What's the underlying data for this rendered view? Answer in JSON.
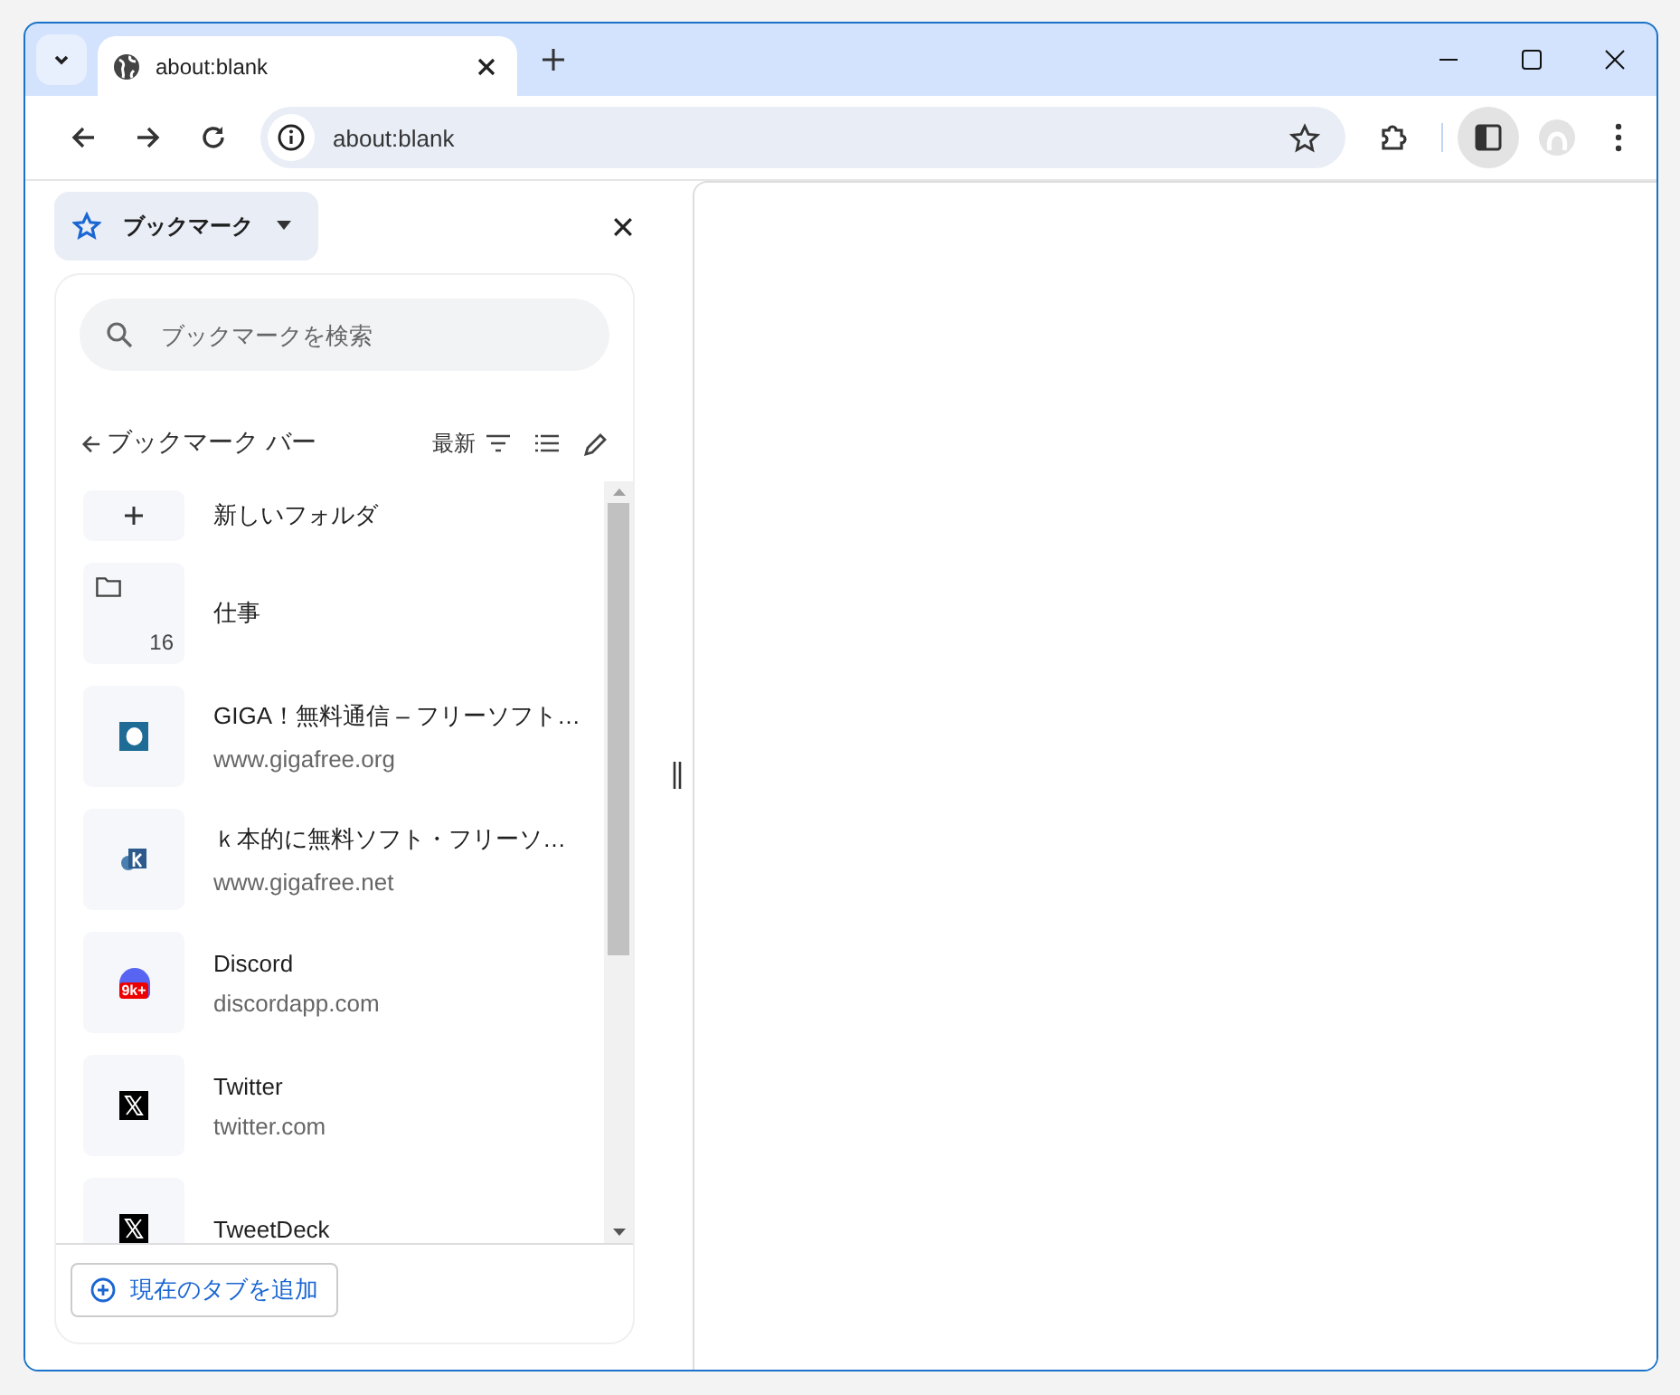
{
  "tab": {
    "title": "about:blank",
    "selected": true
  },
  "address_bar": {
    "value": "about:blank"
  },
  "side_panel": {
    "selector": "ブックマーク",
    "search": {
      "placeholder": "ブックマークを検索"
    },
    "folder_title": "ブックマーク バー",
    "sort": "最新",
    "items": [
      {
        "kind": "new-folder",
        "title": "新しいフォルダ"
      },
      {
        "kind": "folder",
        "title": "仕事",
        "count": "16"
      },
      {
        "kind": "bookmark",
        "title": "GIGA！無料通信 – フリーソフト…",
        "url": "www.gigafree.org"
      },
      {
        "kind": "bookmark",
        "title": "ｋ本的に無料ソフト・フリーソ…",
        "url": "www.gigafree.net"
      },
      {
        "kind": "bookmark",
        "badge": "9k+",
        "title": "Discord",
        "url": "discordapp.com"
      },
      {
        "kind": "bookmark",
        "title": "Twitter",
        "url": "twitter.com"
      },
      {
        "kind": "bookmark",
        "title": "TweetDeck"
      }
    ],
    "add_button": "現在のタブを追加"
  }
}
